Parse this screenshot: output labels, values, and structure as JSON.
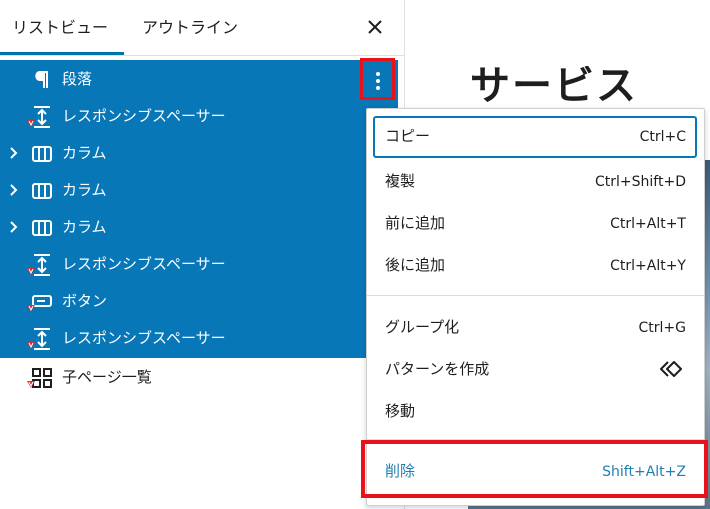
{
  "panel": {
    "tabs": [
      {
        "label": "リストビュー",
        "active": true
      },
      {
        "label": "アウトライン",
        "active": false
      }
    ],
    "close_icon": "close-icon",
    "accent_color": "#0877b8"
  },
  "list": {
    "items": [
      {
        "label": "段落",
        "icon": "paragraph-icon",
        "selected": true,
        "expandable": false
      },
      {
        "label": "レスポンシブスペーサー",
        "icon": "spacer-icon",
        "selected": true,
        "expandable": false
      },
      {
        "label": "カラム",
        "icon": "columns-icon",
        "selected": true,
        "expandable": true
      },
      {
        "label": "カラム",
        "icon": "columns-icon",
        "selected": true,
        "expandable": true
      },
      {
        "label": "カラム",
        "icon": "columns-icon",
        "selected": true,
        "expandable": true
      },
      {
        "label": "レスポンシブスペーサー",
        "icon": "spacer-icon",
        "selected": true,
        "expandable": false
      },
      {
        "label": "ボタン",
        "icon": "button-icon",
        "selected": true,
        "expandable": false
      },
      {
        "label": "レスポンシブスペーサー",
        "icon": "spacer-icon",
        "selected": true,
        "expandable": false
      },
      {
        "label": "子ページ一覧",
        "icon": "child-pages-icon",
        "selected": false,
        "expandable": false
      }
    ],
    "options_icon": "more-vertical-icon"
  },
  "canvas": {
    "title_fragment": "サービス"
  },
  "menu": {
    "items": [
      {
        "label": "コピー",
        "shortcut": "Ctrl+C"
      },
      {
        "label": "複製",
        "shortcut": "Ctrl+Shift+D"
      },
      {
        "label": "前に追加",
        "shortcut": "Ctrl+Alt+T"
      },
      {
        "label": "後に追加",
        "shortcut": "Ctrl+Alt+Y"
      },
      {
        "label": "グループ化",
        "shortcut": "Ctrl+G"
      },
      {
        "label": "パターンを作成",
        "shortcut_icon": "pattern-icon"
      },
      {
        "label": "移動",
        "shortcut": ""
      },
      {
        "label": "削除",
        "shortcut": "Shift+Alt+Z"
      }
    ],
    "danger_color": "#1e7fb0",
    "highlight_color": "#e8121a"
  }
}
